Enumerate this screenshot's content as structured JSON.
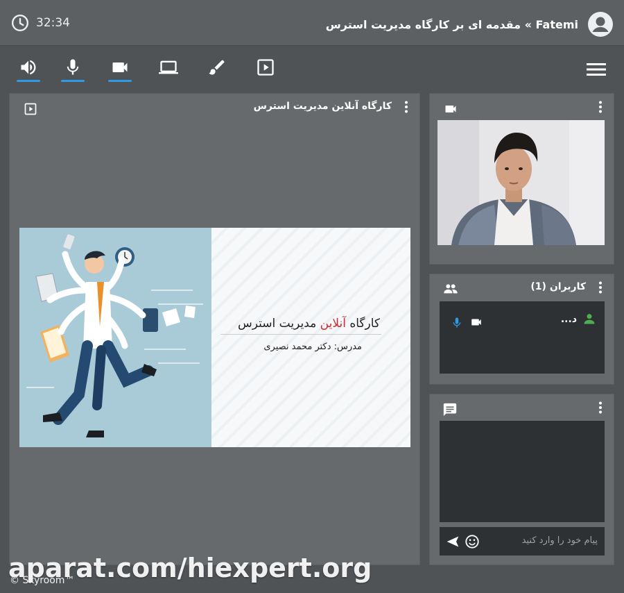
{
  "header": {
    "timer": "32:34",
    "title": "Fatemi » مقدمه ای بر کارگاه مدیریت استرس"
  },
  "toolbar": {
    "buttons": [
      {
        "name": "speaker-icon",
        "active": true
      },
      {
        "name": "microphone-icon",
        "active": true
      },
      {
        "name": "camera-icon",
        "active": true
      },
      {
        "name": "screen-share-icon",
        "active": false
      },
      {
        "name": "brush-icon",
        "active": false
      },
      {
        "name": "presentation-icon",
        "active": false
      }
    ],
    "menu_icon": "hamburger-menu-icon"
  },
  "presentation": {
    "panel_title": "کارگاه آنلاین مدیریت استرس",
    "slide": {
      "title_before": "کارگاه",
      "title_highlight": "آنلاین",
      "title_after": "مدیریت استرس",
      "subtitle": "مدرس: دکتر محمد نصیری"
    }
  },
  "users": {
    "panel_title": "کاربران (1)",
    "list": [
      {
        "name": "د..."
      }
    ]
  },
  "chat": {
    "placeholder": "پیام خود را وارد کنید"
  },
  "watermark": "aparat.com/hiexpert.org",
  "footer": {
    "copyright": "© Skyroom™"
  },
  "colors": {
    "accent": "#2f9be7",
    "highlight": "#d3262e",
    "user_online": "#4caf50"
  }
}
